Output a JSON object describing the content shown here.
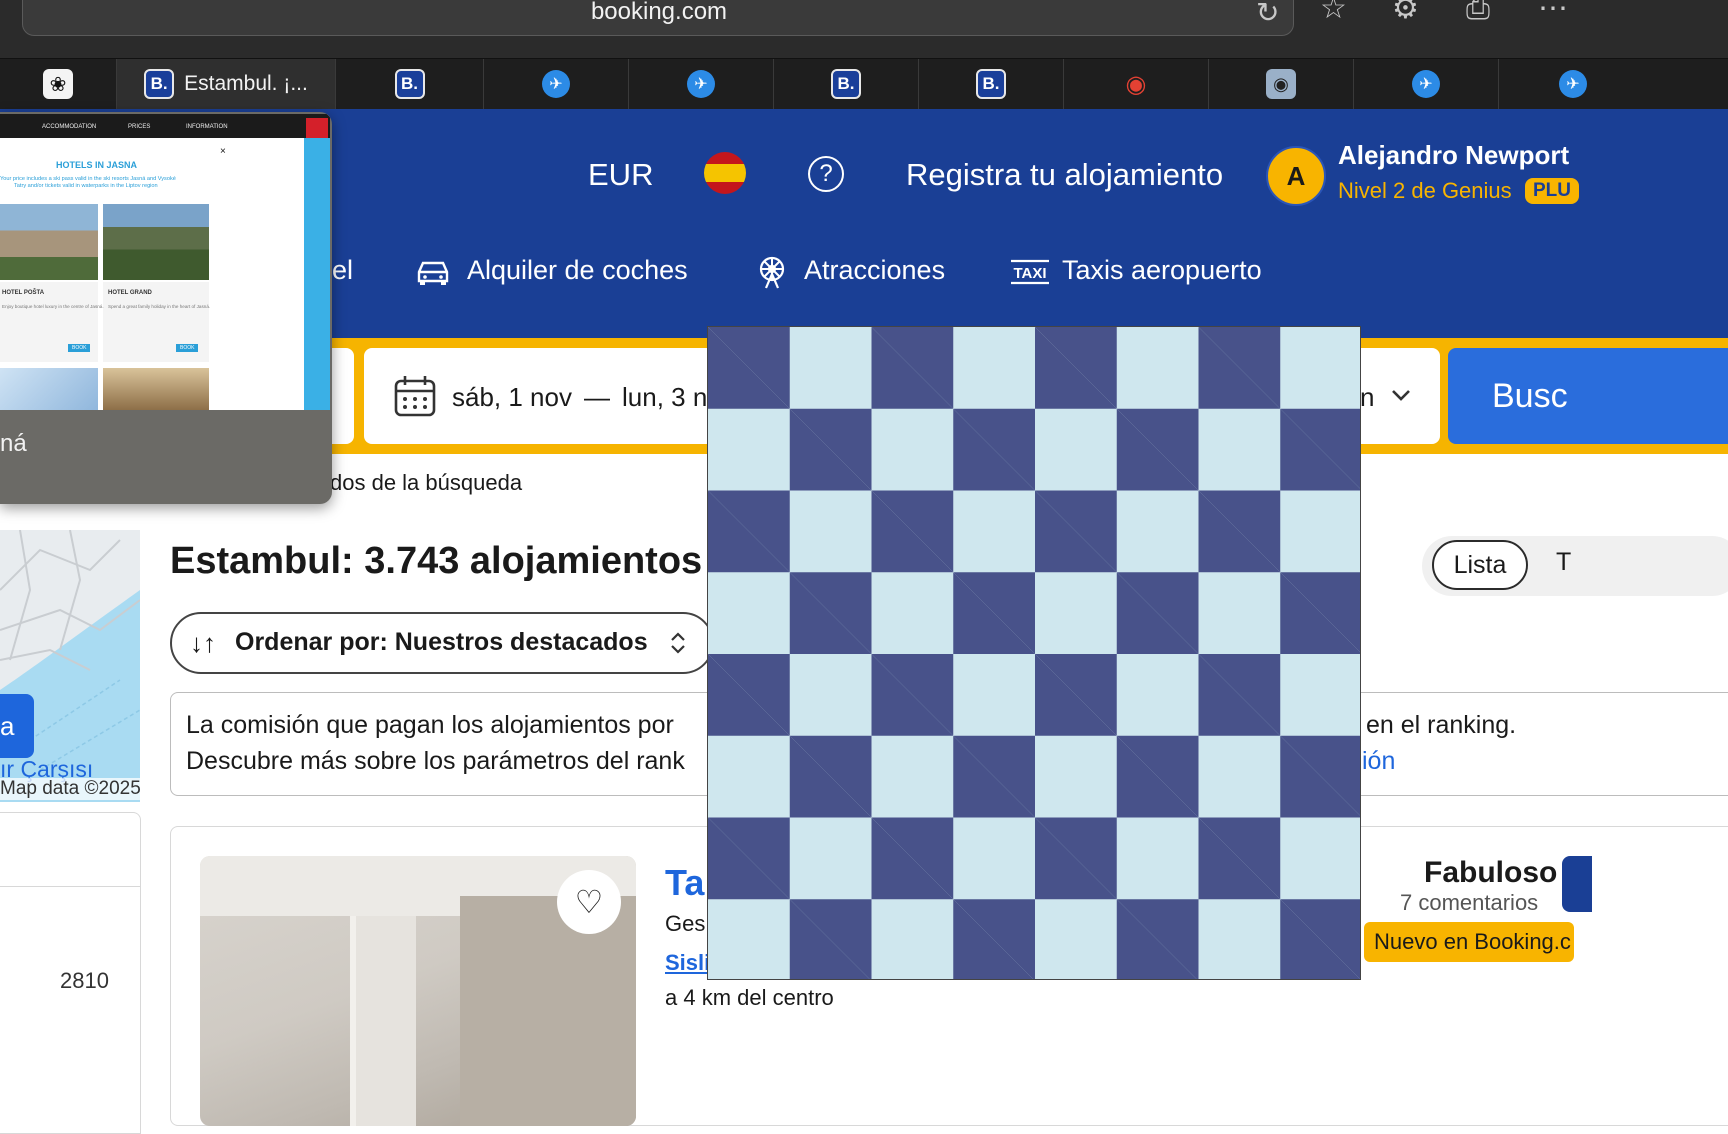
{
  "browser": {
    "url": "booking.com",
    "tabs": [
      {
        "icon": "chatgpt-icon",
        "title": ""
      },
      {
        "icon": "booking-icon",
        "title": "Estambul. ¡..."
      },
      {
        "icon": "booking-icon",
        "title": ""
      },
      {
        "icon": "plane-icon",
        "title": ""
      },
      {
        "icon": "plane-icon",
        "title": ""
      },
      {
        "icon": "booking-icon",
        "title": ""
      },
      {
        "icon": "booking-icon",
        "title": ""
      },
      {
        "icon": "google-maps-icon",
        "title": ""
      },
      {
        "icon": "disney-icon",
        "title": ""
      },
      {
        "icon": "plane-icon",
        "title": ""
      }
    ],
    "favicon_letter": "B."
  },
  "header": {
    "currency": "EUR",
    "list_property": "Registra tu alojamiento",
    "user_initial": "A",
    "user_name": "Alejandro Newport",
    "genius_level": "Nivel 2 de Genius",
    "genius_plus": "PLU"
  },
  "nav": {
    "items": [
      {
        "label": "el",
        "icon": "bed-icon"
      },
      {
        "label": "Alquiler de coches",
        "icon": "car-icon"
      },
      {
        "label": "Atracciones",
        "icon": "attractions-icon"
      },
      {
        "label": "Taxis aeropuerto",
        "icon": "taxi-icon"
      }
    ]
  },
  "search": {
    "dates_start": "sáb, 1 nov",
    "dates_sep": "—",
    "dates_end": "lun, 3 n",
    "occupancy_partial": "n",
    "button_label": "Busc"
  },
  "breadcrumb_partial": "dos de la búsqueda",
  "map": {
    "label": "a",
    "place": "ır Çarşısı",
    "attribution": "Map data ©2025"
  },
  "filter_value": "2810",
  "results": {
    "title": "Estambul: 3.743 alojamientos",
    "sort_label": "Ordenar por: Nuestros destacados",
    "notice_line1": "La comisión que pagan los alojamientos por",
    "notice_line1_end": "en el ranking.",
    "notice_line2": "Descubre más sobre los parámetros del rank",
    "notice_link_end": "ión",
    "view_list": "Lista",
    "view_other": "T"
  },
  "hotel": {
    "name_partial": "Ta",
    "manager_partial": "Ges",
    "location_partial": "Sisli",
    "distance": "a 4 km del centro",
    "rating_word": "Fabuloso",
    "reviews": "7 comentarios",
    "badge": "Nuevo en Booking.c"
  },
  "preview": {
    "nav1": "ACCOMMODATION",
    "nav2": "PRICES",
    "nav3": "INFORMATION",
    "heading": "HOTELS IN JASNA",
    "sub1": "Your price includes a ski pass valid in the ski resorts Jasná and Vysoké",
    "sub2": "Tatry and/or tickets valid in waterparks in the Liptov region",
    "hotel1": "HOTEL POŠTA",
    "hotel2": "HOTEL GRAND",
    "desc1": "Enjoy boutique hotel luxury in the centre of Jasná.",
    "desc2": "Spend a great family holiday in the heart of Jasná.",
    "book": "BOOK",
    "close": "×",
    "caption": "ná"
  }
}
